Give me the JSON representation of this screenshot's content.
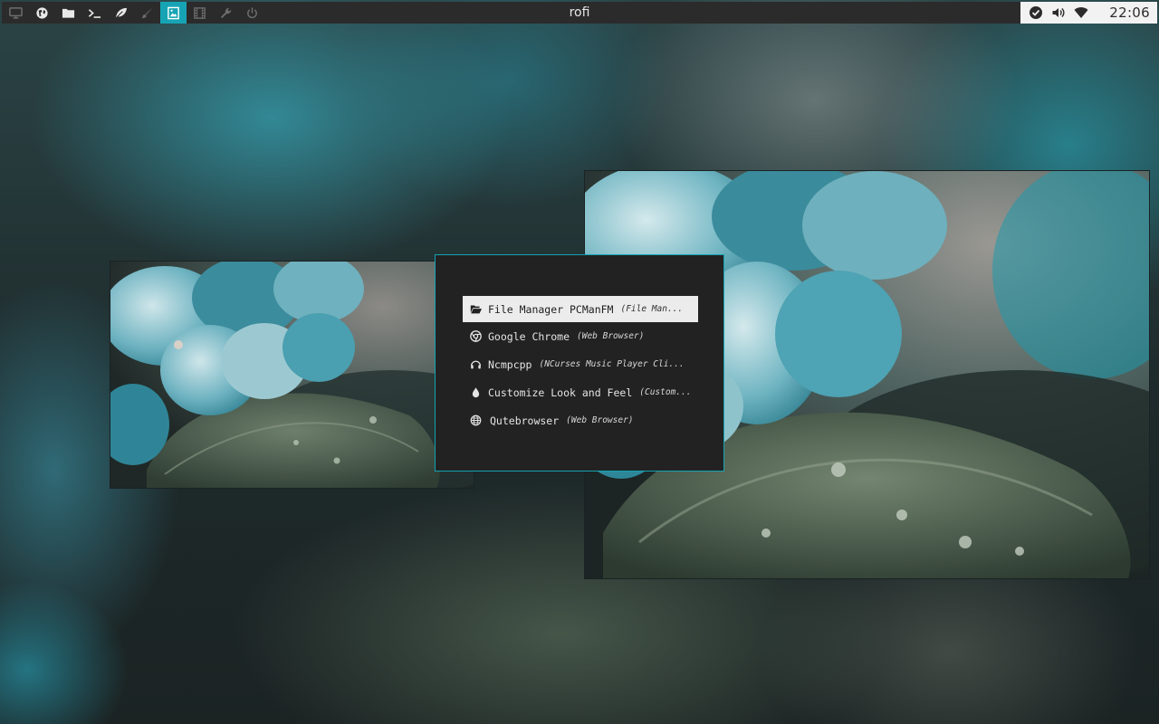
{
  "topbar": {
    "title": "rofi",
    "workspaces": [
      {
        "icon": "monitor-icon",
        "state": "dim"
      },
      {
        "icon": "globe-icon",
        "state": "normal"
      },
      {
        "icon": "folder-icon",
        "state": "normal"
      },
      {
        "icon": "terminal-icon",
        "state": "normal"
      },
      {
        "icon": "leaf-icon",
        "state": "normal"
      },
      {
        "icon": "brush-icon",
        "state": "dim"
      },
      {
        "icon": "image-icon",
        "state": "active"
      },
      {
        "icon": "film-icon",
        "state": "dim"
      },
      {
        "icon": "wrench-icon",
        "state": "dim"
      },
      {
        "icon": "power-icon",
        "state": "dim"
      }
    ],
    "tray": {
      "icons": [
        "check-circle-icon",
        "volume-icon",
        "wifi-icon"
      ],
      "clock": "22:06"
    },
    "colors": {
      "bar": "#2b2b2b",
      "accent": "#16a4b4",
      "tray": "#f2f2f2"
    }
  },
  "rofi": {
    "items": [
      {
        "icon": "folder-open-icon",
        "name": "File Manager PCManFM",
        "description": "(File Man...",
        "selected": true
      },
      {
        "icon": "chrome-icon",
        "name": "Google Chrome",
        "description": "(Web Browser)",
        "selected": false
      },
      {
        "icon": "headphones-icon",
        "name": "Ncmpcpp",
        "description": "(NCurses Music Player Cli...",
        "selected": false
      },
      {
        "icon": "droplet-icon",
        "name": "Customize Look and Feel",
        "description": "(Custom...",
        "selected": false
      },
      {
        "icon": "globe-icon",
        "name": "Qutebrowser",
        "description": "(Web Browser)",
        "selected": false
      }
    ],
    "colors": {
      "background": "#222222",
      "border": "#15a2b2",
      "selected_bg": "#ececec"
    }
  }
}
